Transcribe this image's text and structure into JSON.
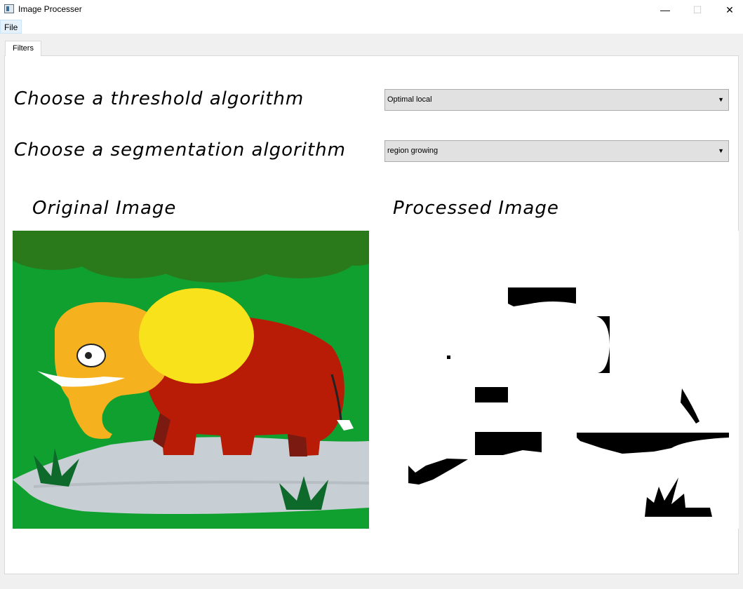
{
  "window": {
    "title": "Image Processer",
    "minimize_glyph": "—",
    "maximize_glyph": "☐",
    "close_glyph": "✕"
  },
  "menu": {
    "file_label": "File"
  },
  "tabs": [
    {
      "label": "Filters",
      "active": true
    }
  ],
  "threshold": {
    "label": "Choose a threshold algorithm",
    "selected": "Optimal local",
    "arrow": "▼"
  },
  "segmentation": {
    "label": "Choose a segmentation algorithm",
    "selected": "region growing",
    "arrow": "▼"
  },
  "images": {
    "original_label": "Original Image",
    "processed_label": "Processed Image"
  },
  "colors": {
    "grass_green": "#10a030",
    "tree_dark_green": "#2a7a1c",
    "elephant_red": "#b81c06",
    "elephant_head": "#f6b21e",
    "ear_yellow": "#f8e21c",
    "rock_gray": "#c8cfd4"
  }
}
